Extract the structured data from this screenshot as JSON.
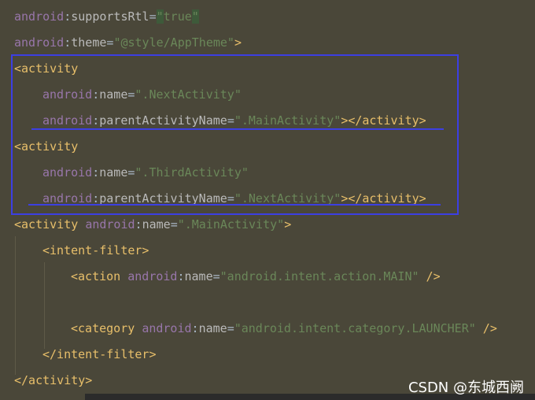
{
  "editor": {
    "lines": [
      {
        "parts": [
          {
            "cls": "ns",
            "t": "android"
          },
          {
            "cls": "punct",
            "t": ":"
          },
          {
            "cls": "attr",
            "t": "supportsRtl"
          },
          {
            "cls": "punct",
            "t": "="
          },
          {
            "cls": "hl",
            "t": "\""
          },
          {
            "cls": "val",
            "t": "true"
          },
          {
            "cls": "hl",
            "t": "\""
          }
        ]
      },
      {
        "parts": [
          {
            "cls": "ns",
            "t": "android"
          },
          {
            "cls": "punct",
            "t": ":"
          },
          {
            "cls": "attr",
            "t": "theme"
          },
          {
            "cls": "punct",
            "t": "="
          },
          {
            "cls": "val",
            "t": "\"@style/AppTheme\""
          },
          {
            "cls": "tag",
            "t": ">"
          }
        ]
      },
      {
        "parts": [
          {
            "cls": "tag",
            "t": "<activity"
          }
        ]
      },
      {
        "parts": [
          {
            "cls": "ns",
            "t": "android"
          },
          {
            "cls": "punct",
            "t": ":"
          },
          {
            "cls": "attr",
            "t": "name"
          },
          {
            "cls": "punct",
            "t": "="
          },
          {
            "cls": "val",
            "t": "\".NextActivity\""
          }
        ]
      },
      {
        "parts": [
          {
            "cls": "ns",
            "t": "android"
          },
          {
            "cls": "punct",
            "t": ":"
          },
          {
            "cls": "attr",
            "t": "parentActivityName"
          },
          {
            "cls": "punct",
            "t": "="
          },
          {
            "cls": "val",
            "t": "\".MainActivity\""
          },
          {
            "cls": "tag",
            "t": "></activity>"
          }
        ]
      },
      {
        "parts": [
          {
            "cls": "tag",
            "t": "<activity"
          }
        ]
      },
      {
        "parts": [
          {
            "cls": "ns",
            "t": "android"
          },
          {
            "cls": "punct",
            "t": ":"
          },
          {
            "cls": "attr",
            "t": "name"
          },
          {
            "cls": "punct",
            "t": "="
          },
          {
            "cls": "val",
            "t": "\".ThirdActivity\""
          }
        ]
      },
      {
        "parts": [
          {
            "cls": "ns",
            "t": "android"
          },
          {
            "cls": "punct",
            "t": ":"
          },
          {
            "cls": "attr",
            "t": "parentActivityName"
          },
          {
            "cls": "punct",
            "t": "="
          },
          {
            "cls": "val",
            "t": "\".NextActivity\""
          },
          {
            "cls": "tag",
            "t": "></activity>"
          }
        ]
      },
      {
        "parts": [
          {
            "cls": "tag",
            "t": "<activity "
          },
          {
            "cls": "ns",
            "t": "android"
          },
          {
            "cls": "punct",
            "t": ":"
          },
          {
            "cls": "attr",
            "t": "name"
          },
          {
            "cls": "punct",
            "t": "="
          },
          {
            "cls": "val",
            "t": "\".MainActivity\""
          },
          {
            "cls": "tag",
            "t": ">"
          }
        ]
      },
      {
        "parts": [
          {
            "cls": "tag",
            "t": "<intent-filter>"
          }
        ]
      },
      {
        "parts": [
          {
            "cls": "tag",
            "t": "<action "
          },
          {
            "cls": "ns",
            "t": "android"
          },
          {
            "cls": "punct",
            "t": ":"
          },
          {
            "cls": "attr",
            "t": "name"
          },
          {
            "cls": "punct",
            "t": "="
          },
          {
            "cls": "val",
            "t": "\"android.intent.action.MAIN\""
          },
          {
            "cls": "tag",
            "t": " />"
          }
        ]
      },
      {
        "parts": []
      },
      {
        "parts": [
          {
            "cls": "tag",
            "t": "<category "
          },
          {
            "cls": "ns",
            "t": "android"
          },
          {
            "cls": "punct",
            "t": ":"
          },
          {
            "cls": "attr",
            "t": "name"
          },
          {
            "cls": "punct",
            "t": "="
          },
          {
            "cls": "val",
            "t": "\"android.intent.category.LAUNCHER\""
          },
          {
            "cls": "tag",
            "t": " />"
          }
        ]
      },
      {
        "parts": [
          {
            "cls": "tag",
            "t": "</intent-filter>"
          }
        ]
      },
      {
        "parts": [
          {
            "cls": "tag",
            "t": "</activity>"
          }
        ]
      }
    ]
  },
  "watermark": "CSDN @东城西阙",
  "colors": {
    "annotation_box": "#3c3fe2",
    "background": "#4a4739"
  }
}
